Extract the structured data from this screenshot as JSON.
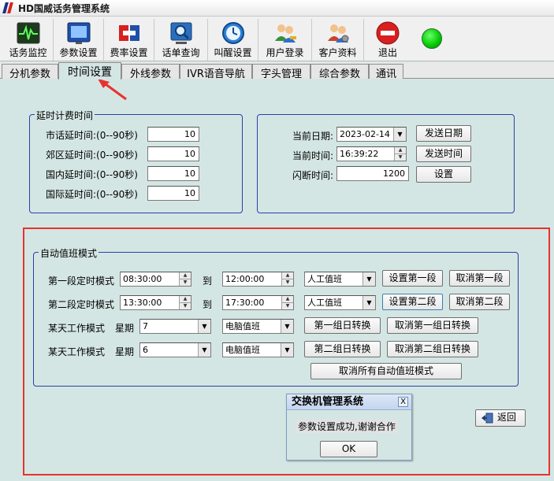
{
  "window": {
    "title": "HD国威话务管理系统"
  },
  "toolbar": {
    "buttons": [
      {
        "label": "话务监控",
        "icon": "monitor-icon"
      },
      {
        "label": "参数设置",
        "icon": "parameter-icon"
      },
      {
        "label": "费率设置",
        "icon": "rate-icon"
      },
      {
        "label": "话单查询",
        "icon": "search-record-icon"
      },
      {
        "label": "叫醒设置",
        "icon": "alarm-clock-icon"
      },
      {
        "label": "用户登录",
        "icon": "user-login-icon"
      },
      {
        "label": "客户资料",
        "icon": "customer-icon"
      },
      {
        "label": "退出",
        "icon": "exit-icon"
      }
    ],
    "status_color": "#00c800"
  },
  "tabs": [
    "分机参数",
    "时间设置",
    "外线参数",
    "IVR语音导航",
    "字头管理",
    "综合参数",
    "通讯"
  ],
  "active_tab": "时间设置",
  "delay_billing": {
    "title": "延时计费时间",
    "rows": [
      {
        "label": "市话延时间:(0--90秒)",
        "value": "10"
      },
      {
        "label": "郊区延时间:(0--90秒)",
        "value": "10"
      },
      {
        "label": "国内延时间:(0--90秒)",
        "value": "10"
      },
      {
        "label": "国际延时间:(0--90秒)",
        "value": "10"
      }
    ]
  },
  "datetime": {
    "date_label": "当前日期:",
    "date_value": "2023-02-14",
    "send_date_label": "发送日期",
    "time_label": "当前时间:",
    "time_value": "16:39:22",
    "send_time_label": "发送时间",
    "flash_label": "闪断时间:",
    "flash_value": "1200",
    "set_label": "设置"
  },
  "auto_duty": {
    "title": "自动值班模式",
    "to_label": "到",
    "period1": {
      "label": "第一段定时模式",
      "start": "08:30:00",
      "end": "12:00:00",
      "mode": "人工值班",
      "set_label": "设置第一段",
      "cancel_label": "取消第一段"
    },
    "period2": {
      "label": "第二段定时模式",
      "start": "13:30:00",
      "end": "17:30:00",
      "mode": "人工值班",
      "set_label": "设置第二段",
      "cancel_label": "取消第二段"
    },
    "day1": {
      "label": "某天工作模式",
      "week_label": "星期",
      "day": "7",
      "mode": "电脑值班",
      "convert_label": "第一组日转换",
      "cancel_label": "取消第一组日转换"
    },
    "day2": {
      "label": "某天工作模式",
      "week_label": "星期",
      "day": "6",
      "mode": "电脑值班",
      "convert_label": "第二组日转换",
      "cancel_label": "取消第二组日转换"
    },
    "cancel_all_label": "取消所有自动值班模式"
  },
  "back_label": "返回",
  "dialog": {
    "title": "交换机管理系统",
    "message": "参数设置成功,谢谢合作",
    "ok_label": "OK",
    "close_glyph": "X"
  },
  "highlight_color": "#e8322f"
}
